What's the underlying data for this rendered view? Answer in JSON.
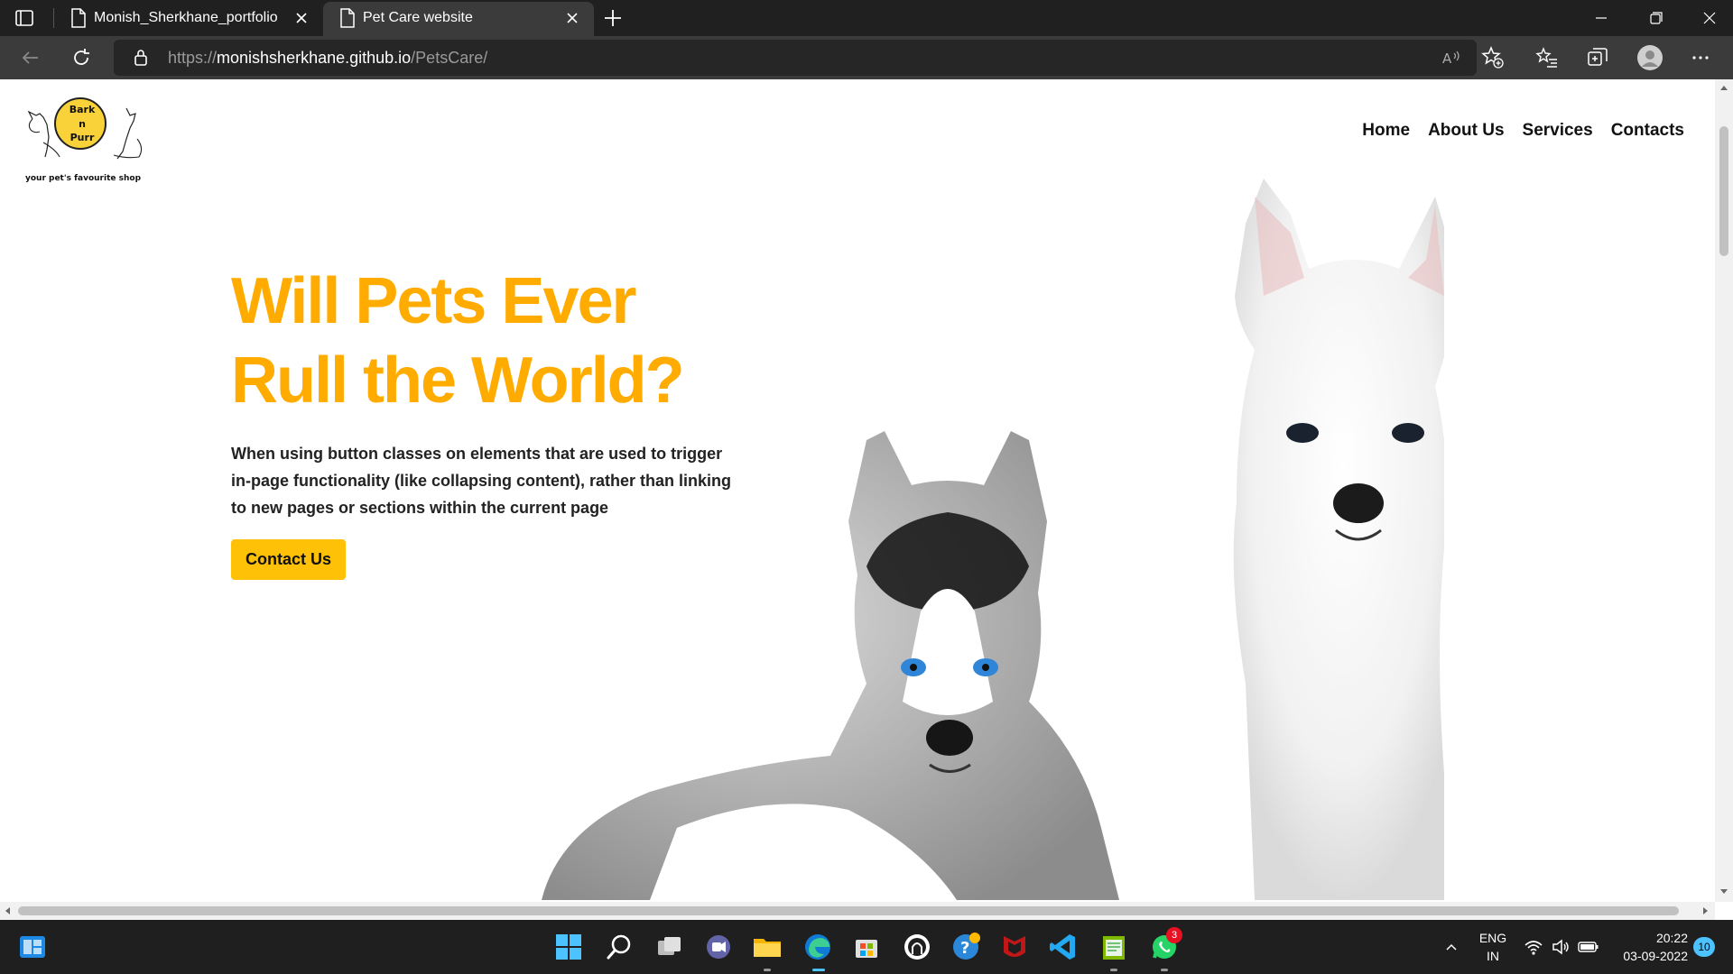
{
  "browser": {
    "tabs": [
      {
        "title": "Monish_Sherkhane_portfolio",
        "active": false
      },
      {
        "title": "Pet Care website",
        "active": true
      }
    ],
    "url_scheme": "https://",
    "url_host": "monishsherkhane.github.io",
    "url_path": "/PetsCare/"
  },
  "site": {
    "logo": {
      "line1": "Bark",
      "line2": "n",
      "line3": "Purr",
      "tagline": "your pet's favourite shop"
    },
    "nav": [
      "Home",
      "About Us",
      "Services",
      "Contacts"
    ],
    "hero": {
      "title": "Will Pets Ever Rull the World?",
      "text": "When using button classes on elements that are used to trigger in-page functionality (like collapsing content), rather than linking to new pages or sections within the current page",
      "cta": "Contact Us"
    },
    "colors": {
      "accent": "#ffab00",
      "button": "#ffc107"
    }
  },
  "taskbar": {
    "lang_line1": "ENG",
    "lang_line2": "IN",
    "time": "20:22",
    "date": "03-09-2022",
    "notifications": "10",
    "whatsapp_badge": "3",
    "icons": [
      "start-icon",
      "search-icon",
      "task-view-icon",
      "teams-chat-icon",
      "file-explorer-icon",
      "edge-icon",
      "store-icon",
      "github-icon",
      "help-icon",
      "mcafee-icon",
      "vscode-icon",
      "notepad-icon",
      "whatsapp-icon"
    ]
  }
}
